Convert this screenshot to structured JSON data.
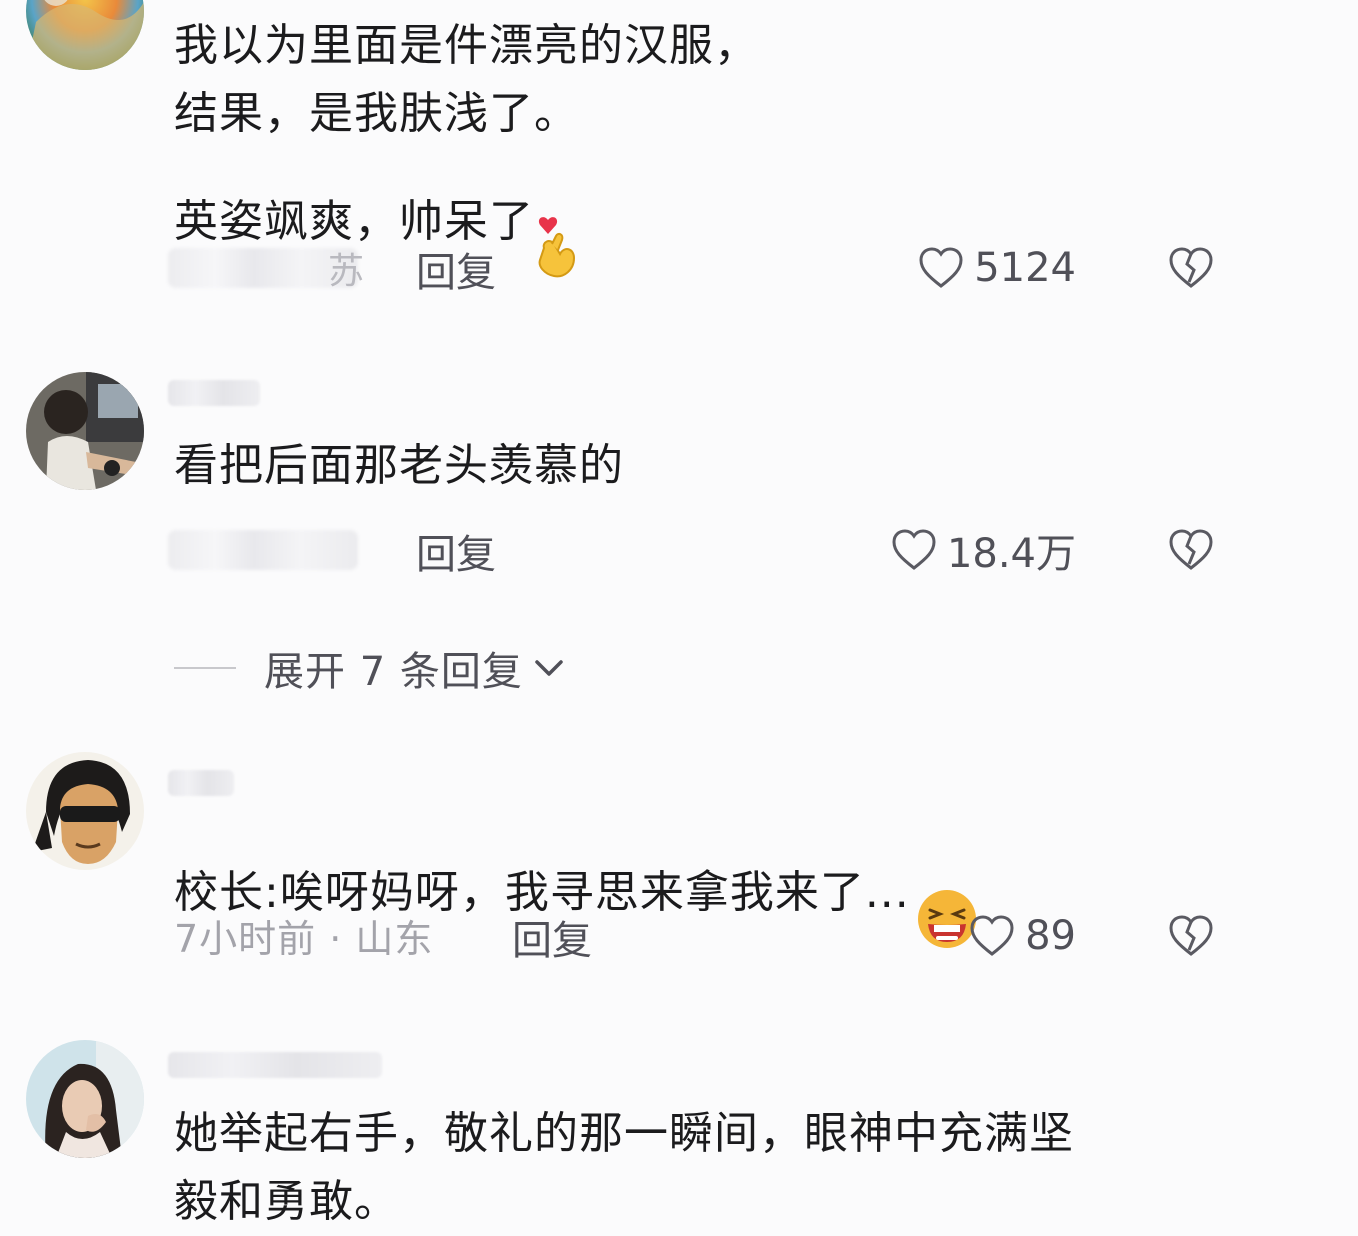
{
  "comments": [
    {
      "text": "我以为里面是件漂亮的汉服，\n结果，是我肤浅了。\n英姿飒爽，帅呆了",
      "emoji": "finger-heart",
      "location_tail": "苏",
      "reply_label": "回复",
      "like_count": "5124"
    },
    {
      "text": "看把后面那老头羡慕的",
      "reply_label": "回复",
      "like_count": "18.4万",
      "expand_label": "展开 7 条回复"
    },
    {
      "text": "校长:唉呀妈呀，我寻思来拿我来了...",
      "emoji": "laughing-face",
      "time_location": "7小时前 · 山东",
      "reply_label": "回复",
      "like_count": "89"
    },
    {
      "text": "她举起右手，敬礼的那一瞬间，眼神中充满坚\n毅和勇敢。"
    }
  ],
  "colors": {
    "background": "#fbfbfc",
    "text_primary": "#1b1b1d",
    "text_secondary": "#505058",
    "text_muted": "#a3a3aa"
  }
}
